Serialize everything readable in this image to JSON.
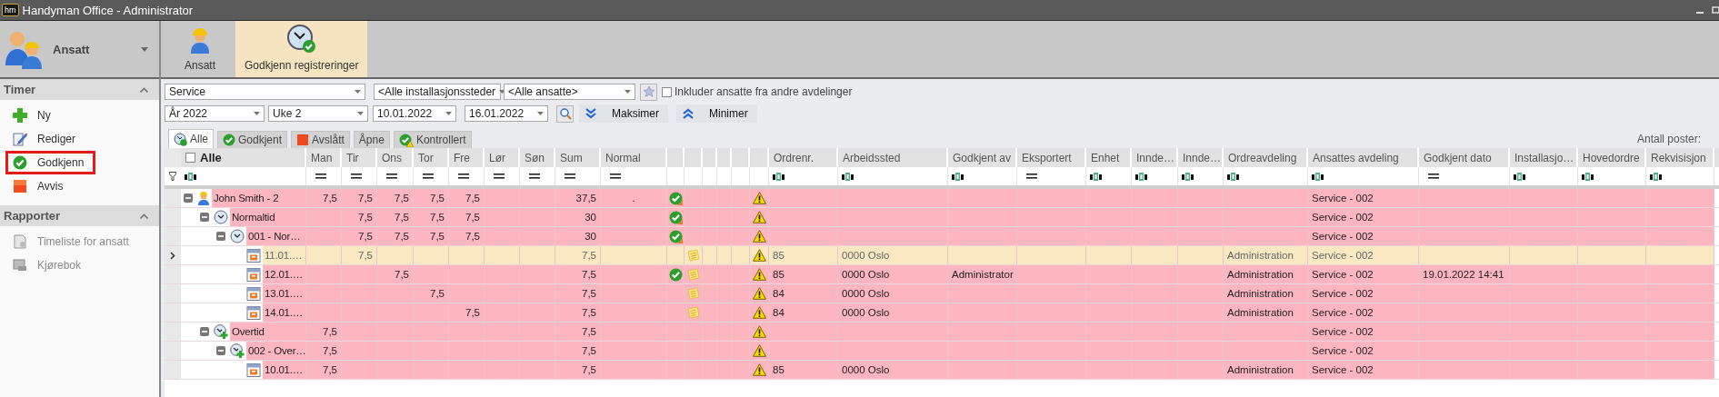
{
  "window": {
    "logo": "hm",
    "title": "Handyman Office - Administrator"
  },
  "module": {
    "label": "Ansatt"
  },
  "ribbon": [
    {
      "label": "Ansatt",
      "kind": "employee",
      "selected": false
    },
    {
      "label": "Godkjenn registreringer",
      "kind": "approve",
      "selected": true
    }
  ],
  "sidebar": [
    {
      "title": "Timer",
      "expanded": true,
      "items": [
        {
          "label": "Ny",
          "kind": "new",
          "selected": false,
          "disabled": false
        },
        {
          "label": "Rediger",
          "kind": "edit",
          "selected": false,
          "disabled": false
        },
        {
          "label": "Godkjenn",
          "kind": "approve",
          "selected": true,
          "disabled": false
        },
        {
          "label": "Avvis",
          "kind": "reject",
          "selected": false,
          "disabled": false
        }
      ]
    },
    {
      "title": "Rapporter",
      "expanded": true,
      "items": [
        {
          "label": "Timeliste for ansatt",
          "kind": "report",
          "selected": false,
          "disabled": true
        },
        {
          "label": "Kjørebok",
          "kind": "logbook",
          "selected": false,
          "disabled": true
        }
      ]
    }
  ],
  "filters": {
    "department": "Service",
    "location": "<Alle installasjonssteder",
    "employee": "<Alle ansatte>",
    "include_other": {
      "label": "Inkluder ansatte fra andre avdelinger",
      "checked": false
    },
    "year": "År 2022",
    "week": "Uke 2",
    "from": "10.01.2022",
    "to": "16.01.2022",
    "maximize": "Maksimer",
    "minimize": "Minimer"
  },
  "tabs": [
    {
      "label": "Alle",
      "kind": "all",
      "selected": true
    },
    {
      "label": "Godkjent",
      "kind": "approved",
      "selected": false
    },
    {
      "label": "Avslått",
      "kind": "rejected",
      "selected": false
    },
    {
      "label": "Åpne",
      "kind": "open",
      "selected": false
    },
    {
      "label": "Kontrollert",
      "kind": "checked",
      "selected": false
    }
  ],
  "record_count_label": "Antall poster:",
  "table": {
    "select_all": {
      "label": "Alle",
      "checked": false
    },
    "columns": [
      {
        "kind": "name",
        "text_filter": true
      },
      {
        "label": "Man",
        "kind": "hours",
        "text_filter": false
      },
      {
        "label": "Tir",
        "kind": "hours",
        "text_filter": false
      },
      {
        "label": "Ons",
        "kind": "hours",
        "text_filter": false
      },
      {
        "label": "Tor",
        "kind": "hours",
        "text_filter": false
      },
      {
        "label": "Fre",
        "kind": "hours",
        "text_filter": false
      },
      {
        "label": "Lør",
        "kind": "hours",
        "text_filter": false
      },
      {
        "label": "Søn",
        "kind": "hours",
        "text_filter": false
      },
      {
        "label": "Sum",
        "kind": "hours",
        "text_filter": false
      },
      {
        "label": "Normal",
        "kind": "center",
        "text_filter": false
      },
      {
        "kind": "status"
      },
      {
        "kind": "note"
      },
      {
        "kind": "blank"
      },
      {
        "kind": "blank"
      },
      {
        "kind": "blank"
      },
      {
        "kind": "warning"
      },
      {
        "label": "Ordrenr.",
        "kind": "text",
        "text_filter": true
      },
      {
        "label": "Arbeidssted",
        "kind": "text",
        "text_filter": true
      },
      {
        "label": "Godkjent av",
        "kind": "text",
        "text_filter": true
      },
      {
        "label": "Eksportert",
        "kind": "text",
        "text_filter": false
      },
      {
        "label": "Enhet",
        "kind": "text",
        "text_filter": true
      },
      {
        "label": "Innde…",
        "kind": "text",
        "text_filter": true
      },
      {
        "label": "Innde…",
        "kind": "text",
        "text_filter": true
      },
      {
        "label": "Ordreavdeling",
        "kind": "text",
        "text_filter": true
      },
      {
        "label": "Ansattes avdeling",
        "kind": "text",
        "text_filter": true
      },
      {
        "label": "Godkjent dato",
        "kind": "text",
        "text_filter": false
      },
      {
        "label": "Installasjo…",
        "kind": "text",
        "text_filter": true
      },
      {
        "label": "Hovedordre",
        "kind": "text",
        "text_filter": true
      },
      {
        "label": "Rekvisisjon",
        "kind": "text",
        "text_filter": true
      }
    ],
    "rows": [
      {
        "kind": "employee",
        "expanded": true,
        "selected": false,
        "partly_approved": true,
        "approved": false,
        "note": false,
        "warning": true,
        "cells": [
          "John Smith - 2",
          "7,5",
          "7,5",
          "7,5",
          "7,5",
          "7,5",
          "",
          "",
          "37,5",
          ".",
          "",
          "",
          "",
          "",
          "",
          "",
          "",
          "",
          "",
          "",
          "",
          "",
          "",
          "",
          "Service - 002"
        ],
        "children": [
          {
            "kind": "normal_time",
            "expanded": true,
            "selected": false,
            "partly_approved": true,
            "approved": false,
            "note": false,
            "warning": true,
            "cells": [
              "Normaltid",
              "",
              "7,5",
              "7,5",
              "7,5",
              "7,5",
              "",
              "",
              "30",
              "",
              "",
              "",
              "",
              "",
              "",
              "",
              "",
              "",
              "",
              "",
              "",
              "",
              "",
              "",
              "Service - 002"
            ],
            "children": [
              {
                "kind": "normal_time",
                "expanded": true,
                "selected": false,
                "partly_approved": true,
                "approved": false,
                "note": false,
                "warning": true,
                "cells": [
                  "001 - Nor…",
                  "",
                  "7,5",
                  "7,5",
                  "7,5",
                  "7,5",
                  "",
                  "",
                  "30",
                  "",
                  "",
                  "",
                  "",
                  "",
                  "",
                  "",
                  "",
                  "",
                  "",
                  "",
                  "",
                  "",
                  "",
                  "",
                  "Service - 002"
                ],
                "children": [
                  {
                    "kind": "day",
                    "selected": true,
                    "partly_approved": false,
                    "approved": false,
                    "note": true,
                    "warning": true,
                    "cells": [
                      "11.01.…",
                      "",
                      "7,5",
                      "",
                      "",
                      "",
                      "",
                      "",
                      "7,5",
                      "",
                      "",
                      "",
                      "",
                      "",
                      "",
                      "",
                      "85",
                      "0000 Oslo",
                      "",
                      "",
                      "",
                      "",
                      "",
                      "Administration",
                      "Service - 002"
                    ]
                  },
                  {
                    "kind": "day",
                    "selected": false,
                    "partly_approved": false,
                    "approved": true,
                    "note": true,
                    "warning": true,
                    "cells": [
                      "12.01.…",
                      "",
                      "",
                      "7,5",
                      "",
                      "",
                      "",
                      "",
                      "7,5",
                      "",
                      "",
                      "",
                      "",
                      "",
                      "",
                      "",
                      "85",
                      "0000 Oslo",
                      "Administrator",
                      "",
                      "",
                      "",
                      "",
                      "Administration",
                      "Service - 002",
                      "19.01.2022 14:41"
                    ]
                  },
                  {
                    "kind": "day",
                    "selected": false,
                    "partly_approved": false,
                    "approved": false,
                    "note": true,
                    "warning": true,
                    "cells": [
                      "13.01.…",
                      "",
                      "",
                      "",
                      "7,5",
                      "",
                      "",
                      "",
                      "7,5",
                      "",
                      "",
                      "",
                      "",
                      "",
                      "",
                      "",
                      "84",
                      "0000 Oslo",
                      "",
                      "",
                      "",
                      "",
                      "",
                      "Administration",
                      "Service - 002"
                    ]
                  },
                  {
                    "kind": "day",
                    "selected": false,
                    "partly_approved": false,
                    "approved": false,
                    "note": true,
                    "warning": true,
                    "cells": [
                      "14.01.…",
                      "",
                      "",
                      "",
                      "",
                      "7,5",
                      "",
                      "",
                      "7,5",
                      "",
                      "",
                      "",
                      "",
                      "",
                      "",
                      "",
                      "84",
                      "0000 Oslo",
                      "",
                      "",
                      "",
                      "",
                      "",
                      "Administration",
                      "Service - 002"
                    ]
                  }
                ]
              }
            ]
          },
          {
            "kind": "overtime",
            "expanded": true,
            "selected": false,
            "partly_approved": false,
            "approved": false,
            "note": false,
            "warning": true,
            "cells": [
              "Overtid",
              "7,5",
              "",
              "",
              "",
              "",
              "",
              "",
              "7,5",
              "",
              "",
              "",
              "",
              "",
              "",
              "",
              "",
              "",
              "",
              "",
              "",
              "",
              "",
              "",
              "Service - 002"
            ],
            "children": [
              {
                "kind": "overtime",
                "expanded": true,
                "selected": false,
                "partly_approved": false,
                "approved": false,
                "note": false,
                "warning": true,
                "cells": [
                  "002 - Over…",
                  "7,5",
                  "",
                  "",
                  "",
                  "",
                  "",
                  "",
                  "7,5",
                  "",
                  "",
                  "",
                  "",
                  "",
                  "",
                  "",
                  "",
                  "",
                  "",
                  "",
                  "",
                  "",
                  "",
                  "",
                  "Service - 002"
                ],
                "children": [
                  {
                    "kind": "day",
                    "selected": false,
                    "partly_approved": false,
                    "approved": false,
                    "note": false,
                    "warning": true,
                    "cells": [
                      "10.01.…",
                      "7,5",
                      "",
                      "",
                      "",
                      "",
                      "",
                      "",
                      "7,5",
                      "",
                      "",
                      "",
                      "",
                      "",
                      "",
                      "",
                      "85",
                      "0000 Oslo",
                      "",
                      "",
                      "",
                      "",
                      "",
                      "Administration",
                      "Service - 002"
                    ]
                  }
                ]
              }
            ]
          }
        ]
      }
    ]
  }
}
